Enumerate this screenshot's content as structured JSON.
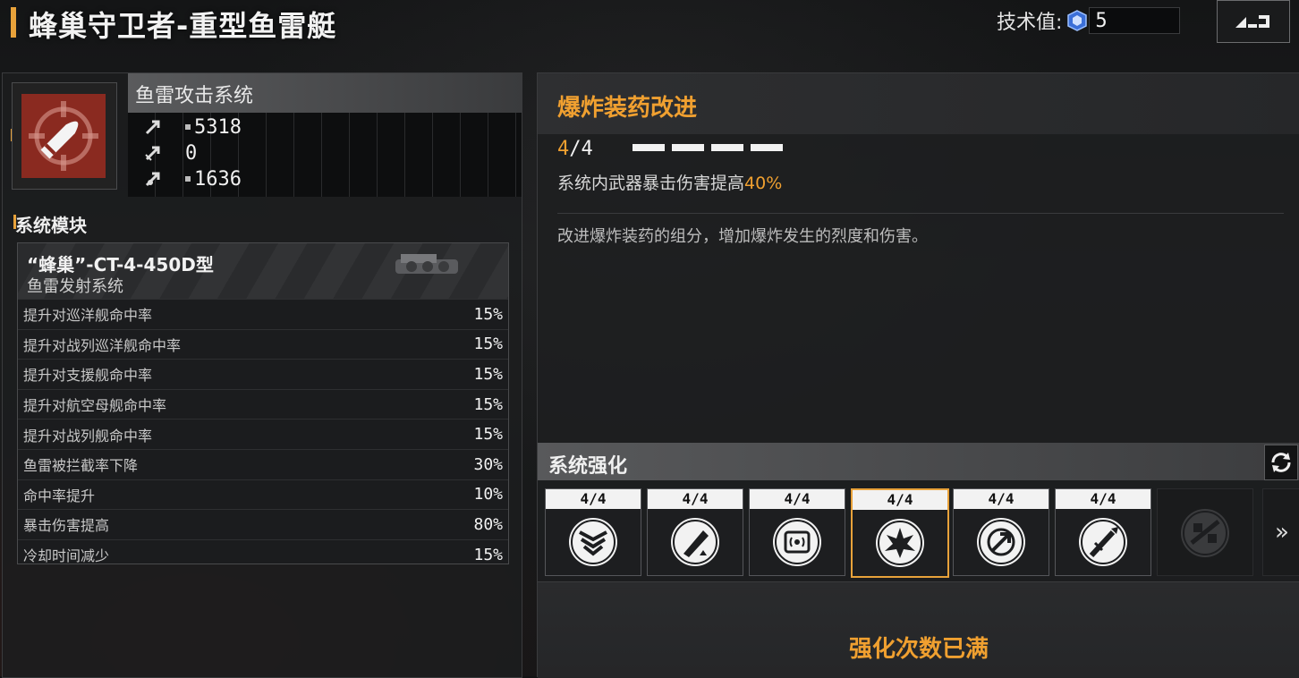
{
  "header": {
    "title": "蜂巢守卫者-重型鱼雷艇",
    "tech_label": "技术值:",
    "tech_value": "5"
  },
  "system": {
    "name": "鱼雷攻击系统",
    "stats": [
      "5318",
      "0",
      "1636"
    ]
  },
  "modules_section": {
    "title": "系统模块",
    "module_name": "“蜂巢”-CT-4-450D型",
    "module_type": "鱼雷发射系统",
    "rows": [
      {
        "label": "提升对巡洋舰命中率",
        "value": "15%"
      },
      {
        "label": "提升对战列巡洋舰命中率",
        "value": "15%"
      },
      {
        "label": "提升对支援舰命中率",
        "value": "15%"
      },
      {
        "label": "提升对航空母舰命中率",
        "value": "15%"
      },
      {
        "label": "提升对战列舰命中率",
        "value": "15%"
      },
      {
        "label": "鱼雷被拦截率下降",
        "value": "30%"
      },
      {
        "label": "命中率提升",
        "value": "10%"
      },
      {
        "label": "暴击伤害提高",
        "value": "80%"
      },
      {
        "label": "冷却时间减少",
        "value": "15%"
      }
    ]
  },
  "upgrade": {
    "title": "爆炸装药改进",
    "level_current": "4",
    "level_sep_max": "/4",
    "effect_text": "系统内武器暴击伤害提高",
    "effect_value": "40%",
    "description": "改进爆炸装药的组分，增加爆炸发生的烈度和伤害。"
  },
  "enhance": {
    "title": "系统强化",
    "slots": [
      {
        "level": "4/4",
        "icon": "armor-chevron-icon"
      },
      {
        "level": "4/4",
        "icon": "pen-upgrade-icon"
      },
      {
        "level": "4/4",
        "icon": "signal-chip-icon"
      },
      {
        "level": "4/4",
        "icon": "explosion-icon"
      },
      {
        "level": "4/4",
        "icon": "target-arrow-icon"
      },
      {
        "level": "4/4",
        "icon": "missile-launch-icon"
      }
    ],
    "locked_icon": "locked-satellite-icon",
    "more": "»",
    "status": "强化次数已满"
  },
  "colors": {
    "accent": "#f0a030",
    "icon_bg": "#8a2a20"
  }
}
